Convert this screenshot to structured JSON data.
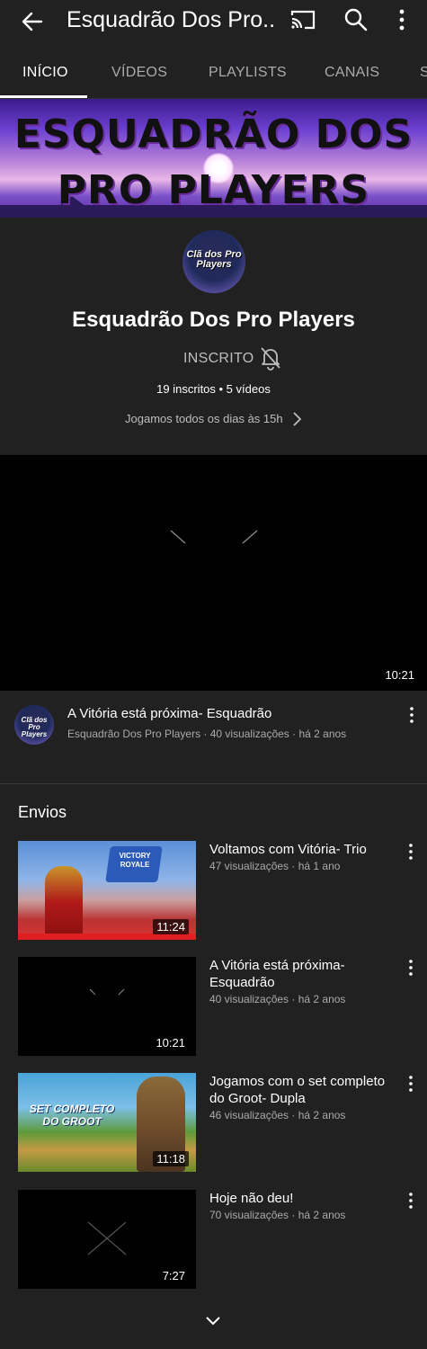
{
  "header": {
    "title": "Esquadrão Dos Pro..."
  },
  "tabs": [
    {
      "label": "INÍCIO",
      "active": true
    },
    {
      "label": "VÍDEOS"
    },
    {
      "label": "PLAYLISTS"
    },
    {
      "label": "CANAIS"
    },
    {
      "label": "S"
    }
  ],
  "banner": {
    "line1": "ESQUADRÃO DOS",
    "line2": "PRO PLAYERS",
    "colors": {
      "sky_top": "#3b1b8a",
      "sky_mid": "#b07ad8"
    }
  },
  "channel": {
    "avatar_text": "Clã dos Pro Players",
    "name": "Esquadrão Dos Pro Players",
    "subscribe_label": "INSCRITO",
    "stats": "19 inscritos • 5 vídeos",
    "about": "Jogamos todos os dias às 15h"
  },
  "featured": {
    "duration": "10:21",
    "title": "A Vitória está próxima- Esquadrão",
    "meta": "Esquadrão Dos Pro Players · 40 visualizações · há 2 anos"
  },
  "uploads": {
    "section_title": "Envios",
    "items": [
      {
        "title": "Voltamos com Vitória- Trio",
        "meta": "47 visualizações · há 1 ano",
        "duration": "11:24",
        "thumb_text": "VICTORY ROYALE"
      },
      {
        "title": "A Vitória está próxima- Esquadrão",
        "meta": "40 visualizações · há 2 anos",
        "duration": "10:21"
      },
      {
        "title": "Jogamos com o set completo do Groot- Dupla",
        "meta": "46 visualizações · há 2 anos",
        "duration": "11:18",
        "thumb_text_1": "SET COMPLETO",
        "thumb_text_2": "DO GROOT"
      },
      {
        "title": "Hoje  não deu!",
        "meta": "70 visualizações · há 2 anos",
        "duration": "7:27"
      }
    ]
  },
  "icons": {
    "back": "arrow-left-icon",
    "cast": "cast-icon",
    "search": "search-icon",
    "more": "more-vert-icon",
    "bell": "bell-off-icon",
    "chevron": "chevron-right-icon",
    "expand": "chevron-down-icon"
  }
}
